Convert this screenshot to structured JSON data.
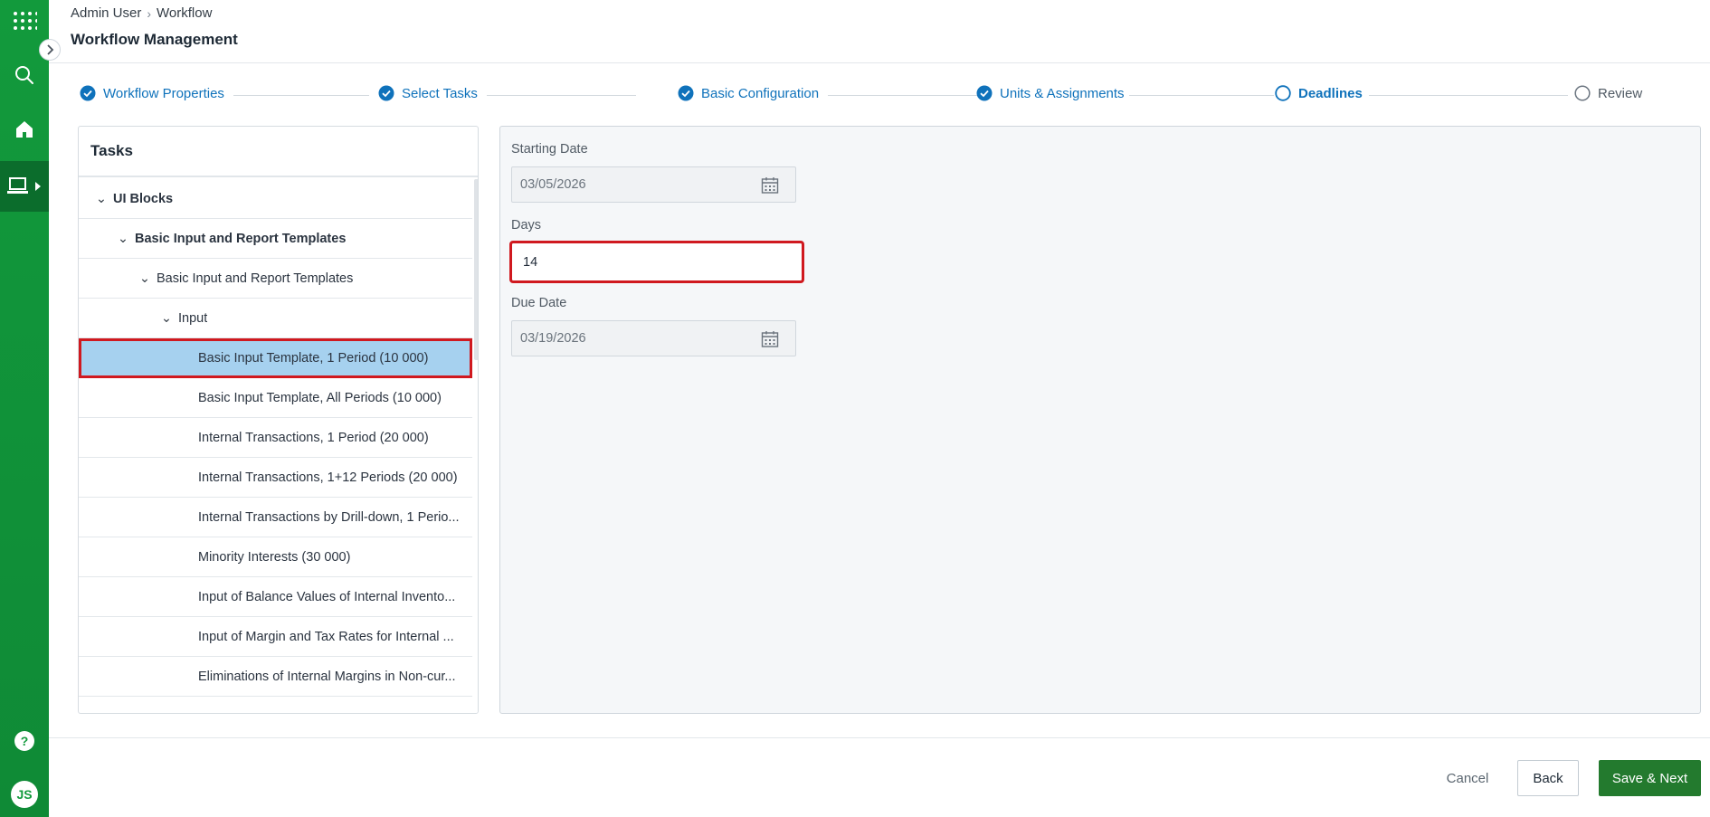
{
  "breadcrumb": {
    "root": "Admin User",
    "current": "Workflow"
  },
  "page_title": "Workflow Management",
  "stepper": {
    "steps": [
      {
        "label": "Workflow Properties",
        "state": "done"
      },
      {
        "label": "Select Tasks",
        "state": "done"
      },
      {
        "label": "Basic Configuration",
        "state": "done"
      },
      {
        "label": "Units & Assignments",
        "state": "done"
      },
      {
        "label": "Deadlines",
        "state": "current"
      },
      {
        "label": "Review",
        "state": "future"
      }
    ]
  },
  "tasks": {
    "title": "Tasks",
    "tree": [
      {
        "label": "UI Blocks",
        "chevron": "⌄"
      },
      {
        "label": "Basic Input and Report Templates",
        "chevron": "⌄"
      },
      {
        "label": "Basic Input and Report Templates",
        "chevron": "⌄"
      },
      {
        "label": "Input",
        "chevron": "⌄"
      },
      {
        "label": "Basic Input Template, 1 Period (10 000)"
      },
      {
        "label": "Basic Input Template, All Periods (10 000)"
      },
      {
        "label": "Internal Transactions, 1 Period (20 000)"
      },
      {
        "label": "Internal Transactions, 1+12 Periods (20 000)"
      },
      {
        "label": "Internal Transactions by Drill-down, 1 Perio..."
      },
      {
        "label": "Minority Interests (30 000)"
      },
      {
        "label": "Input of Balance Values of Internal Invento..."
      },
      {
        "label": "Input of Margin and Tax Rates for Internal ..."
      },
      {
        "label": "Eliminations of Internal Margins in Non-cur..."
      }
    ]
  },
  "form": {
    "starting_date": {
      "label": "Starting Date",
      "value": "03/05/2026"
    },
    "days": {
      "label": "Days",
      "value": "14"
    },
    "due_date": {
      "label": "Due Date",
      "value": "03/19/2026"
    }
  },
  "footer": {
    "cancel": "Cancel",
    "back": "Back",
    "save_next": "Save & Next"
  },
  "user": {
    "initials": "JS"
  },
  "help": {
    "glyph": "?"
  },
  "colors": {
    "brand_green": "#129a3c",
    "accent_blue": "#0f72bb",
    "selected_row": "#a6d1ef",
    "highlight_red": "#d0191f",
    "save_green": "#237a2e"
  }
}
